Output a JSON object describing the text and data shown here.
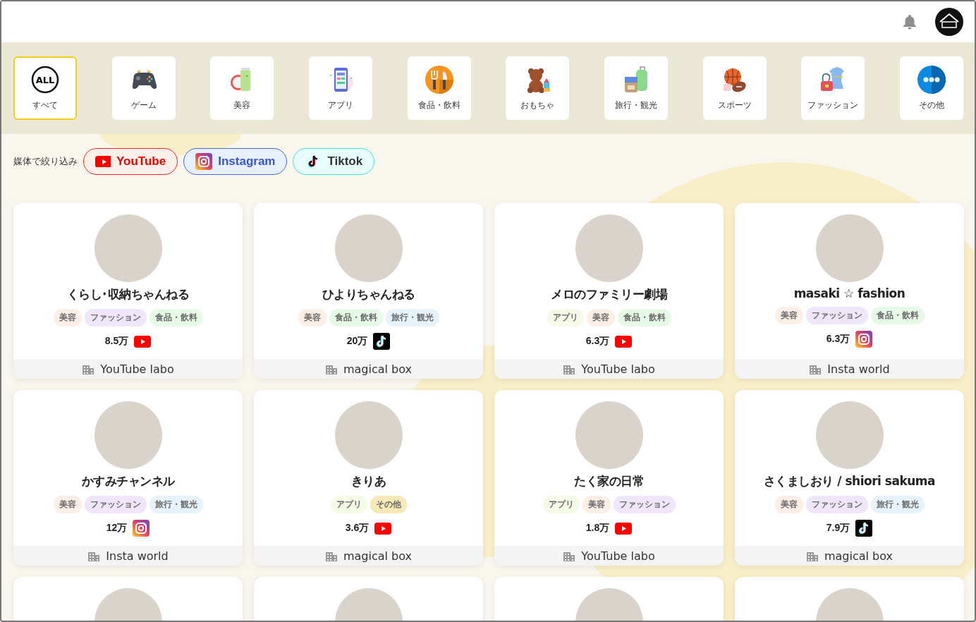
{
  "categories": [
    {
      "label": "すべて",
      "selected": true,
      "icon_text": "ALL"
    },
    {
      "label": "ゲーム",
      "selected": false
    },
    {
      "label": "美容",
      "selected": false
    },
    {
      "label": "アプリ",
      "selected": false
    },
    {
      "label": "食品・飲料",
      "selected": false
    },
    {
      "label": "おもちゃ",
      "selected": false
    },
    {
      "label": "旅行・観光",
      "selected": false
    },
    {
      "label": "スポーツ",
      "selected": false
    },
    {
      "label": "ファッション",
      "selected": false
    },
    {
      "label": "その他",
      "selected": false
    }
  ],
  "filter": {
    "label": "媒体で絞り込み",
    "chips": [
      {
        "label": "YouTube",
        "kind": "youtube"
      },
      {
        "label": "Instagram",
        "kind": "instagram"
      },
      {
        "label": "Tiktok",
        "kind": "tiktok"
      }
    ]
  },
  "creators": [
    {
      "kind": "full",
      "name": "くらし･収納ちゃんねる",
      "tags": [
        {
          "label": "美容",
          "color": "#fdeee6"
        },
        {
          "label": "ファッション",
          "color": "#efe6fb"
        },
        {
          "label": "食品・飲料",
          "color": "#e6f9e6"
        }
      ],
      "followers": {
        "count": "8.5万",
        "kind": "youtube"
      },
      "agency": "YouTube labo"
    },
    {
      "kind": "full",
      "name": "ひよりちゃんねる",
      "tags": [
        {
          "label": "美容",
          "color": "#fdeee6"
        },
        {
          "label": "食品・飲料",
          "color": "#e6f9e6"
        },
        {
          "label": "旅行・観光",
          "color": "#e6f3fd"
        }
      ],
      "followers": {
        "count": "20万",
        "kind": "tiktok"
      },
      "agency": "magical box"
    },
    {
      "kind": "full",
      "name": "メロのファミリー劇場",
      "tags": [
        {
          "label": "アプリ",
          "color": "#f5fbe6"
        },
        {
          "label": "美容",
          "color": "#fdeee6"
        },
        {
          "label": "食品・飲料",
          "color": "#e6f9e6"
        }
      ],
      "followers": {
        "count": "6.3万",
        "kind": "youtube"
      },
      "agency": "YouTube labo"
    },
    {
      "kind": "full",
      "name": "masaki ☆ fashion",
      "tags": [
        {
          "label": "美容",
          "color": "#fdeee6"
        },
        {
          "label": "ファッション",
          "color": "#efe6fb"
        },
        {
          "label": "食品・飲料",
          "color": "#e6f9e6"
        }
      ],
      "followers": {
        "count": "6.3万",
        "kind": "instagram"
      },
      "agency": "Insta world"
    },
    {
      "kind": "full",
      "name": "かすみチャンネル",
      "tags": [
        {
          "label": "美容",
          "color": "#fdeee6"
        },
        {
          "label": "ファッション",
          "color": "#efe6fb"
        },
        {
          "label": "旅行・観光",
          "color": "#e6f3fd"
        }
      ],
      "followers": {
        "count": "12万",
        "kind": "instagram"
      },
      "agency": "Insta world"
    },
    {
      "kind": "full",
      "name": "きりあ",
      "tags": [
        {
          "label": "アプリ",
          "color": "#f5fbe6"
        },
        {
          "label": "その他",
          "color": "#f6e9b5"
        }
      ],
      "followers": {
        "count": "3.6万",
        "kind": "youtube"
      },
      "agency": "magical box"
    },
    {
      "kind": "full",
      "name": "たく家の日常",
      "tags": [
        {
          "label": "アプリ",
          "color": "#f5fbe6"
        },
        {
          "label": "美容",
          "color": "#fdeee6"
        },
        {
          "label": "ファッション",
          "color": "#efe6fb"
        }
      ],
      "followers": {
        "count": "1.8万",
        "kind": "youtube"
      },
      "agency": "YouTube labo"
    },
    {
      "kind": "full",
      "name": "さくましおり / shiori sakuma",
      "tags": [
        {
          "label": "美容",
          "color": "#fdeee6"
        },
        {
          "label": "ファッション",
          "color": "#efe6fb"
        },
        {
          "label": "旅行・観光",
          "color": "#e6f3fd"
        }
      ],
      "followers": {
        "count": "7.9万",
        "kind": "tiktok"
      },
      "agency": "magical box"
    },
    {
      "kind": "partial"
    },
    {
      "kind": "partial"
    },
    {
      "kind": "partial"
    },
    {
      "kind": "partial"
    }
  ]
}
